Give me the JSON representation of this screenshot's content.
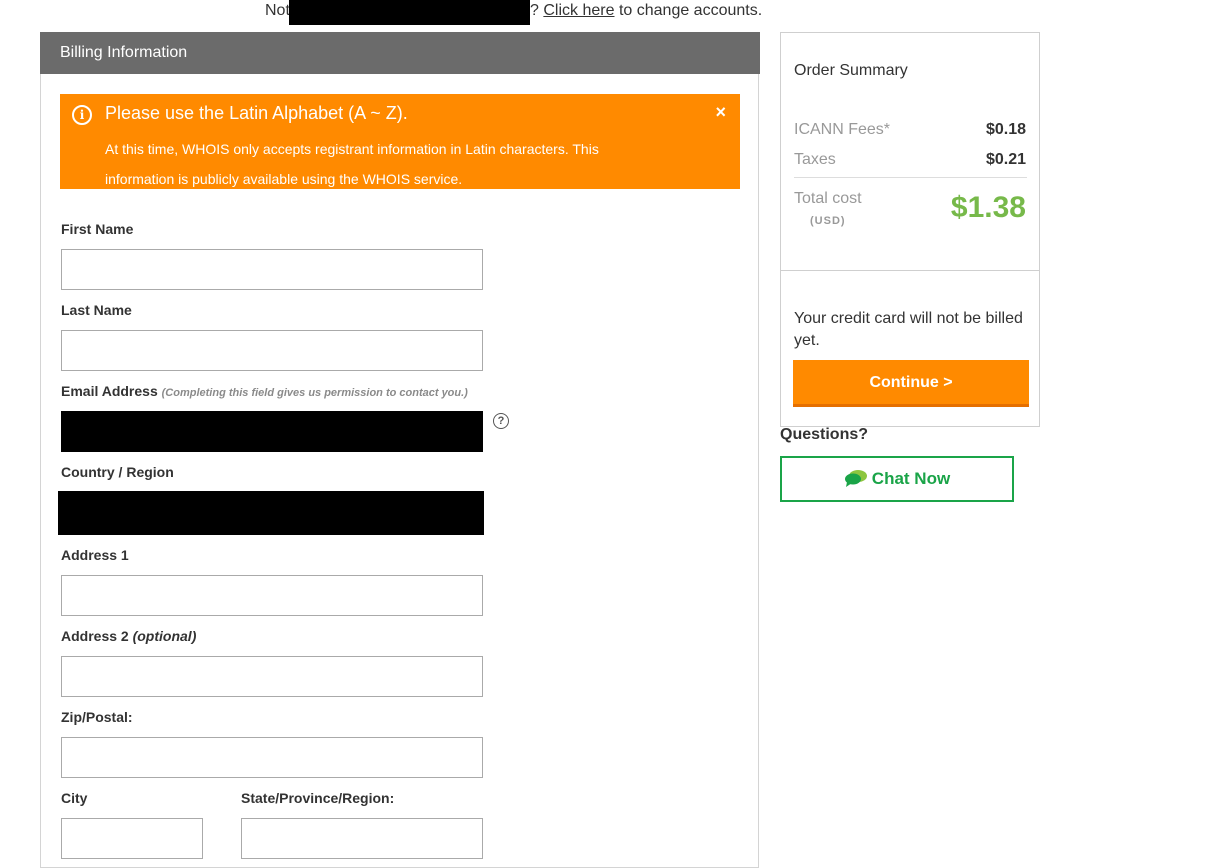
{
  "account": {
    "prefix": "Not",
    "suffix_start": "?",
    "link": "Click here",
    "suffix_end": "to change accounts."
  },
  "billing": {
    "header": "Billing Information",
    "alert": {
      "title": "Please use the Latin Alphabet (A ~ Z).",
      "body": "At this time, WHOIS only accepts registrant information in Latin characters. This information is publicly available using the WHOIS service.",
      "icon": "info-icon",
      "close": "×"
    },
    "fields": {
      "first_name": "First Name",
      "last_name": "Last Name",
      "email": "Email Address",
      "email_note": "(Completing this field gives us permission to contact you.)",
      "country": "Country / Region",
      "address1": "Address 1",
      "address2": "Address 2",
      "address2_note": "(optional)",
      "zip": "Zip/Postal:",
      "city": "City",
      "state": "State/Province/Region:"
    },
    "help_icon": "?"
  },
  "summary": {
    "title": "Order Summary",
    "rows": [
      {
        "label": "ICANN Fees*",
        "value": "$0.18"
      },
      {
        "label": "Taxes",
        "value": "$0.21"
      }
    ],
    "total_label": "Total cost",
    "currency": "(USD)",
    "total_value": "$1.38",
    "billing_note": "Your credit card will not be billed yet.",
    "continue_label": "Continue >"
  },
  "help": {
    "questions": "Questions?",
    "chat_label": "Chat Now"
  },
  "colors": {
    "accent": "#ff8a00",
    "total": "#77b94a",
    "chat": "#1aa448",
    "header": "#6b6b6b"
  }
}
